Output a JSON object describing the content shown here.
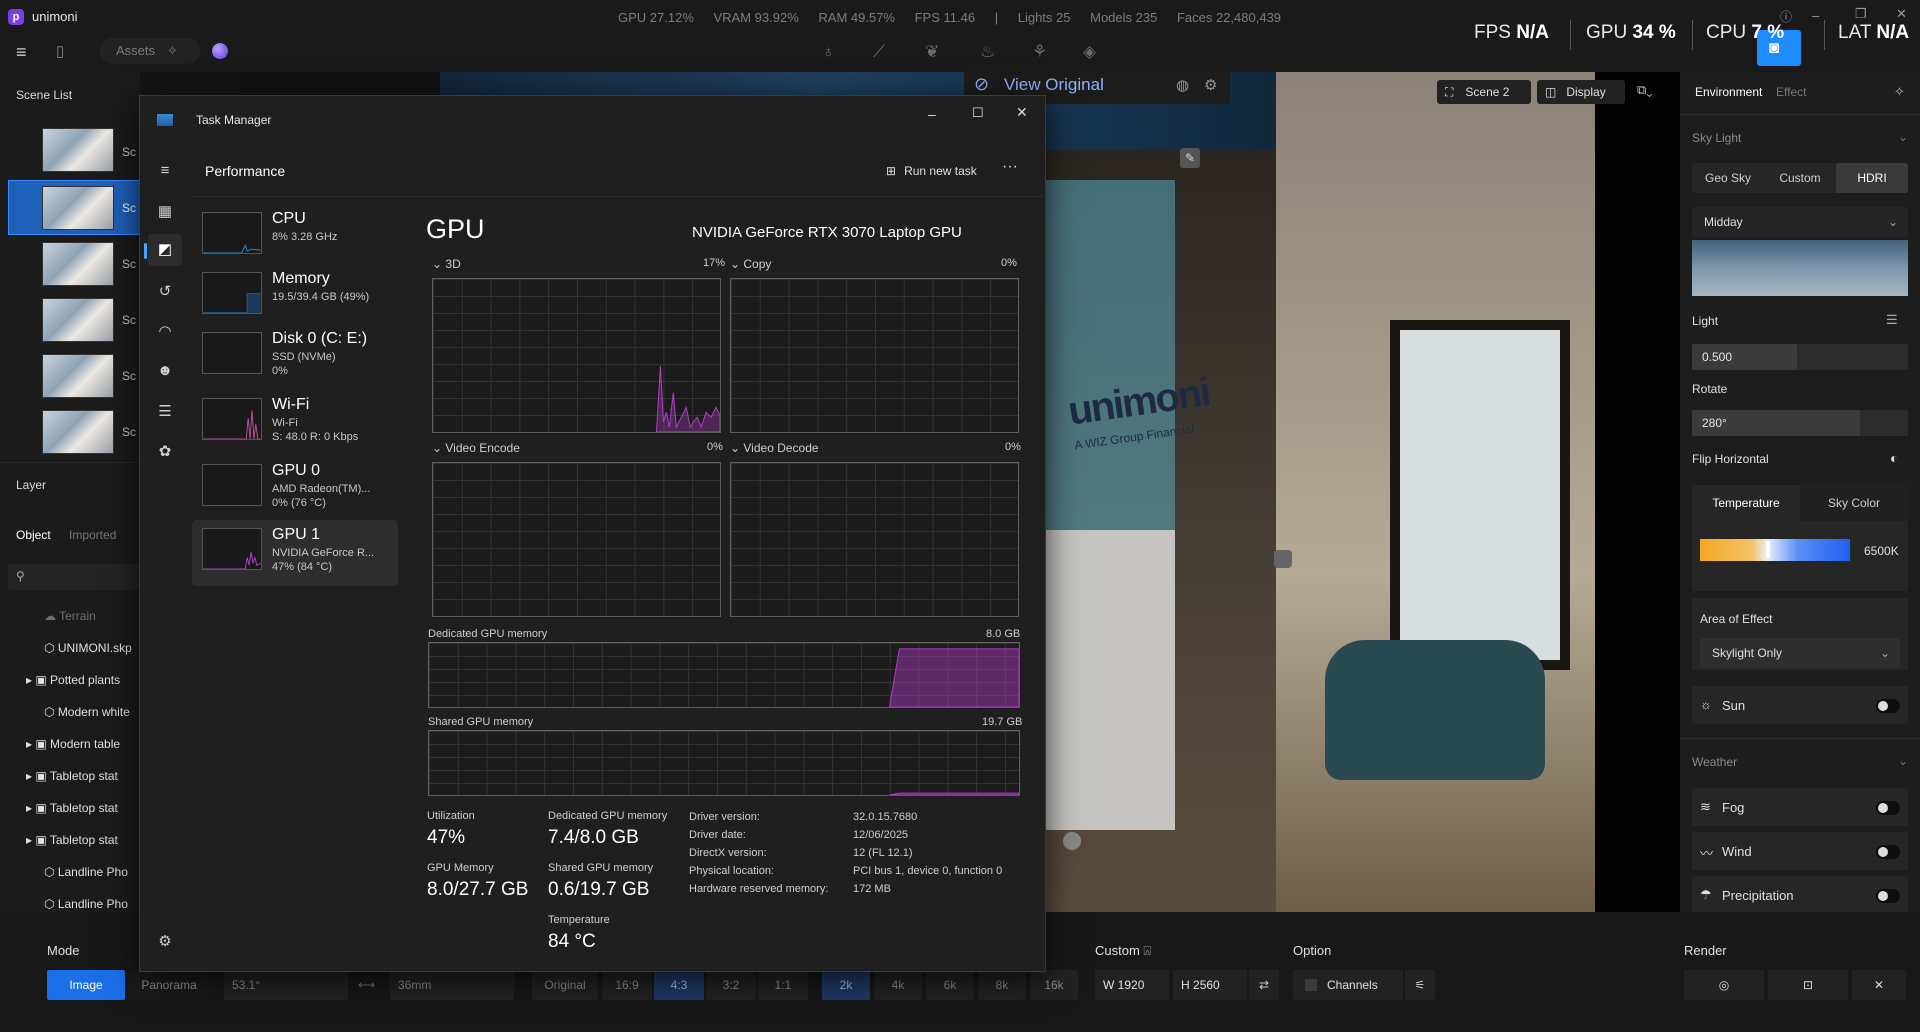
{
  "app": {
    "name": "unimoni",
    "logo_letter": "p"
  },
  "stats": [
    "GPU 27.12%",
    "VRAM 93.92%",
    "RAM 49.57%",
    "FPS 11.46",
    "Lights 25",
    "Models 235",
    "Faces 22,480,439"
  ],
  "perf": {
    "fps_label": "FPS",
    "fps_value": "N/A",
    "gpu_label": "GPU",
    "gpu_value": "34 %",
    "cpu_label": "CPU",
    "cpu_value": "7 %",
    "lat_label": "LAT",
    "lat_value": "N/A"
  },
  "toolbar": {
    "assets_label": "Assets",
    "view_original": "View Original",
    "scene_label": "Scene 2",
    "display_label": "Display"
  },
  "left_panel": {
    "scene_list_title": "Scene List",
    "scenes": [
      "Sc",
      "Sc",
      "Sc",
      "Sc",
      "Sc",
      "Sc"
    ],
    "layer_title": "Layer",
    "tab_object": "Object",
    "tab_imported": "Imported",
    "layers": [
      "Terrain",
      "UNIMONI.skp",
      "Potted plants",
      "Modern white",
      "Modern table",
      "Tabletop stat",
      "Tabletop stat",
      "Tabletop stat",
      "Landline Pho",
      "Landline Pho"
    ]
  },
  "viewport": {
    "sign_main": "unimoni",
    "sign_sub": "A WIZ Group Financial"
  },
  "right_panel": {
    "tab_environment": "Environment",
    "tab_effect": "Effect",
    "sky_light_title": "Sky Light",
    "sky_modes": [
      "Geo Sky",
      "Custom",
      "HDRI"
    ],
    "sky_preset": "Midday",
    "light_label": "Light",
    "light_value": "0.500",
    "rotate_label": "Rotate",
    "rotate_value": "280°",
    "flip_label": "Flip Horizontal",
    "temp_tab": "Temperature",
    "skycolor_tab": "Sky Color",
    "temp_value": "6500K",
    "area_label": "Area of Effect",
    "area_value": "Skylight Only",
    "sun_label": "Sun",
    "weather_title": "Weather",
    "fog_label": "Fog",
    "wind_label": "Wind",
    "precip_label": "Precipitation"
  },
  "bottom": {
    "mode_title": "Mode",
    "image_btn": "Image",
    "panorama_btn": "Panorama",
    "fov": "53.1°",
    "focal": "36mm",
    "ratios": [
      "Original",
      "16:9",
      "4:3",
      "3:2",
      "1:1"
    ],
    "resolutions": [
      "2k",
      "4k",
      "6k",
      "8k",
      "16k"
    ],
    "custom_title": "Custom",
    "width_label": "W",
    "width_value": "1920",
    "height_label": "H",
    "height_value": "2560",
    "option_title": "Option",
    "channels_label": "Channels",
    "render_title": "Render"
  },
  "task_manager": {
    "title": "Task Manager",
    "page": "Performance",
    "run_task": "Run new task",
    "items": [
      {
        "name": "CPU",
        "line2": "8% 3.28 GHz",
        "line3": ""
      },
      {
        "name": "Memory",
        "line2": "19.5/39.4 GB (49%)",
        "line3": ""
      },
      {
        "name": "Disk 0 (C: E:)",
        "line2": "SSD (NVMe)",
        "line3": "0%"
      },
      {
        "name": "Wi-Fi",
        "line2": "Wi-Fi",
        "line3": "S: 48.0 R: 0 Kbps"
      },
      {
        "name": "GPU 0",
        "line2": "AMD Radeon(TM)...",
        "line3": "0% (76 °C)"
      },
      {
        "name": "GPU 1",
        "line2": "NVIDIA GeForce R...",
        "line3": "47% (84 °C)"
      }
    ],
    "gpu_title": "GPU",
    "gpu_model": "NVIDIA GeForce RTX 3070 Laptop GPU",
    "engines": [
      {
        "name": "3D",
        "pct": "17%"
      },
      {
        "name": "Copy",
        "pct": "0%"
      },
      {
        "name": "Video Encode",
        "pct": "0%"
      },
      {
        "name": "Video Decode",
        "pct": "0%"
      }
    ],
    "dedicated_label": "Dedicated GPU memory",
    "dedicated_max": "8.0 GB",
    "shared_label": "Shared GPU memory",
    "shared_max": "19.7 GB",
    "summary": {
      "utilization_label": "Utilization",
      "utilization": "47%",
      "dedicated_label": "Dedicated GPU memory",
      "dedicated": "7.4/8.0 GB",
      "gpu_memory_label": "GPU Memory",
      "gpu_memory": "8.0/27.7 GB",
      "shared_label": "Shared GPU memory",
      "shared": "0.6/19.7 GB",
      "temperature_label": "Temperature",
      "temperature": "84 °C"
    },
    "details": [
      {
        "k": "Driver version:",
        "v": "32.0.15.7680"
      },
      {
        "k": "Driver date:",
        "v": "12/06/2025"
      },
      {
        "k": "DirectX version:",
        "v": "12 (FL 12.1)"
      },
      {
        "k": "Physical location:",
        "v": "PCI bus 1, device 0, function 0"
      },
      {
        "k": "Hardware reserved memory:",
        "v": "172 MB"
      }
    ]
  },
  "colors": {
    "accent": "#1a6fe8",
    "tm_graph": "#b13fc6",
    "brand": "#7b3fe4"
  }
}
